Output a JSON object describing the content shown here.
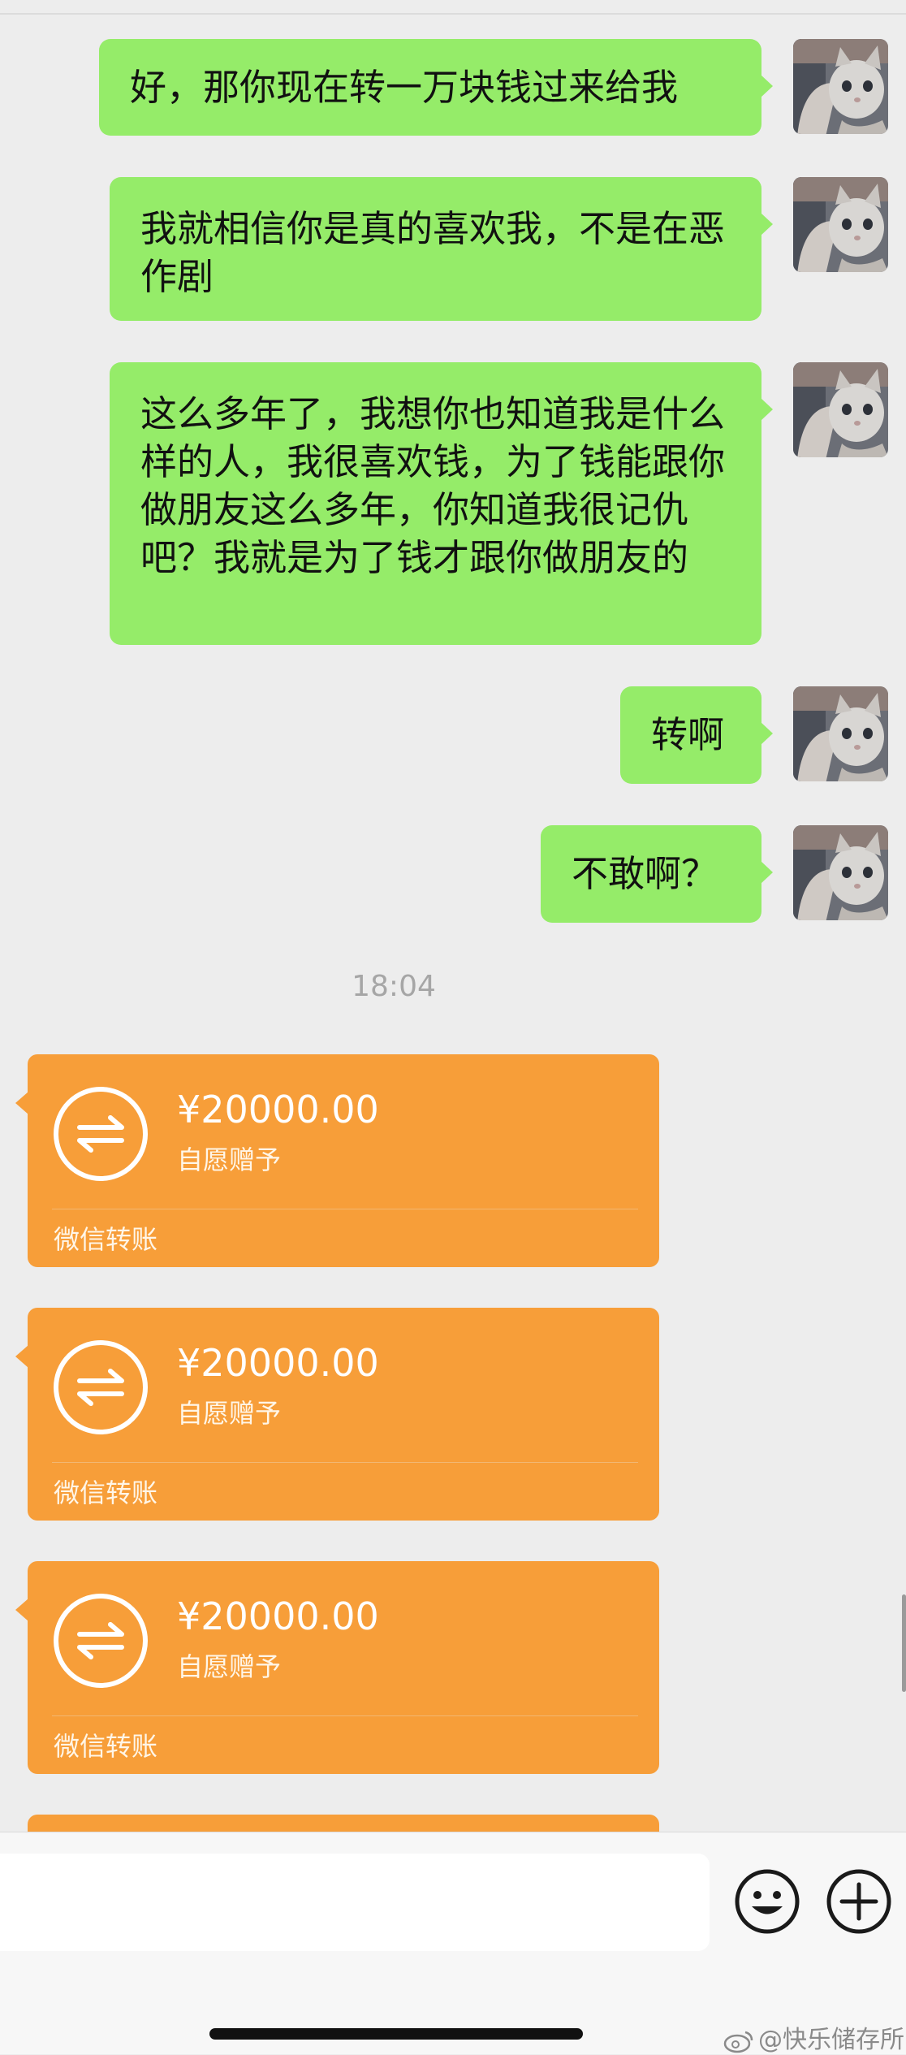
{
  "messages": [
    {
      "text": "好，那你现在转一万块钱过来给我"
    },
    {
      "text": "我就相信你是真的喜欢我，不是在恶作剧"
    },
    {
      "text": "这么多年了，我想你也知道我是什么样的人，我很喜欢钱，为了钱能跟你做朋友这么多年，你知道我很记仇吧？我就是为了钱才跟你做朋友的"
    },
    {
      "text": "转啊"
    },
    {
      "text": "不敢啊？"
    }
  ],
  "timestamp": "18:04",
  "transfers": [
    {
      "amount": "¥20000.00",
      "note": "自愿赠予",
      "footer": "微信转账"
    },
    {
      "amount": "¥20000.00",
      "note": "自愿赠予",
      "footer": "微信转账"
    },
    {
      "amount": "¥20000.00",
      "note": "自愿赠予",
      "footer": "微信转账"
    }
  ],
  "input": {
    "placeholder": ""
  },
  "watermark": "@快乐储存所",
  "icons": {
    "emoji": "emoji-icon",
    "add": "plus-icon",
    "transfer": "transfer-arrows-icon"
  },
  "colors": {
    "outgoing_bubble": "#95ec69",
    "transfer_card": "#f79e39",
    "background": "#ededed"
  }
}
